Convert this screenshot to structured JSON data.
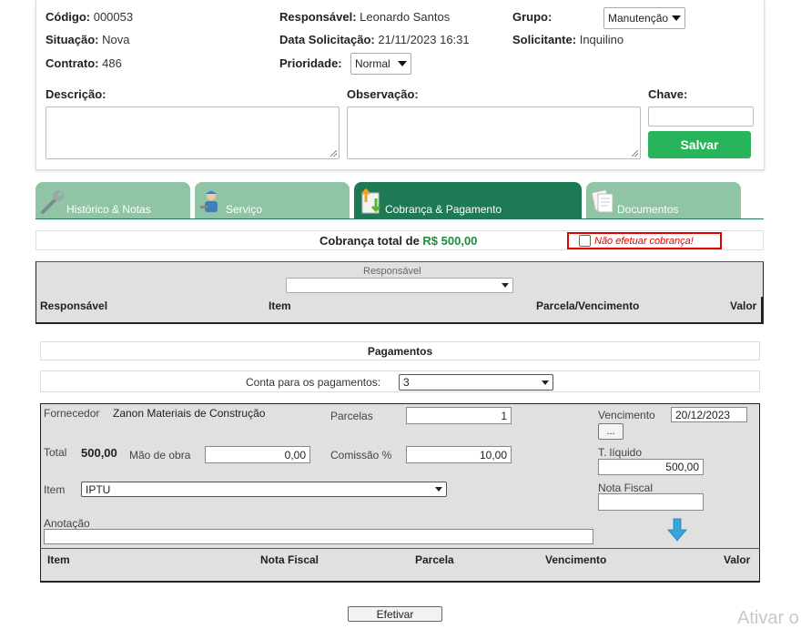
{
  "info": {
    "codigo_label": "Código:",
    "codigo_value": "000053",
    "situacao_label": "Situação:",
    "situacao_value": "Nova",
    "contrato_label": "Contrato:",
    "contrato_value": "486",
    "responsavel_label": "Responsável:",
    "responsavel_value": "Leonardo Santos",
    "data_label": "Data Solicitação:",
    "data_value": "21/11/2023 16:31",
    "prioridade_label": "Prioridade:",
    "prioridade_value": "Normal",
    "grupo_label": "Grupo:",
    "grupo_value": "Manutenção",
    "solicitante_label": "Solicitante:",
    "solicitante_value": "Inquilino"
  },
  "form": {
    "descricao_label": "Descrição:",
    "observacao_label": "Observação:",
    "chave_label": "Chave:",
    "salvar_label": "Salvar"
  },
  "tabs": [
    {
      "label": "Histórico & Notas",
      "icon": "wrench-icon"
    },
    {
      "label": "Serviço",
      "icon": "worker-icon"
    },
    {
      "label": "Cobrança & Pagamento",
      "icon": "payment-icon"
    },
    {
      "label": "Documentos",
      "icon": "documents-icon"
    }
  ],
  "cobranca": {
    "total_label": "Cobrança total de",
    "total_value": "R$ 500,00",
    "nao_efetuar_label": "Não efetuar cobrança!"
  },
  "responsavel_table": {
    "filter_label": "Responsável",
    "filter_value": "",
    "columns": [
      "Responsável",
      "Item",
      "Parcela/Vencimento",
      "Valor"
    ]
  },
  "pagamentos": {
    "title": "Pagamentos",
    "conta_label": "Conta para os pagamentos:",
    "conta_value": "3"
  },
  "payment_form": {
    "fornecedor_label": "Fornecedor",
    "fornecedor_value": "Zanon Materiais de Construção",
    "parcelas_label": "Parcelas",
    "parcelas_value": "1",
    "vencimento_label": "Vencimento",
    "vencimento_value": "20/12/2023",
    "more_label": "...",
    "total_label": "Total",
    "total_value": "500,00",
    "mao_de_obra_label": "Mão de obra",
    "mao_de_obra_value": "0,00",
    "comissao_label": "Comissão %",
    "comissao_value": "10,00",
    "t_liquido_label": "T. líquido",
    "t_liquido_value": "500,00",
    "item_label": "Item",
    "item_value": "IPTU",
    "nota_fiscal_label": "Nota Fiscal",
    "nota_fiscal_value": "",
    "anotacao_label": "Anotação",
    "anotacao_value": "",
    "columns": [
      "Item",
      "Nota Fiscal",
      "Parcela",
      "Vencimento",
      "Valor"
    ]
  },
  "actions": {
    "efetivar_label": "Efetivar"
  },
  "watermark": "Ativar o"
}
